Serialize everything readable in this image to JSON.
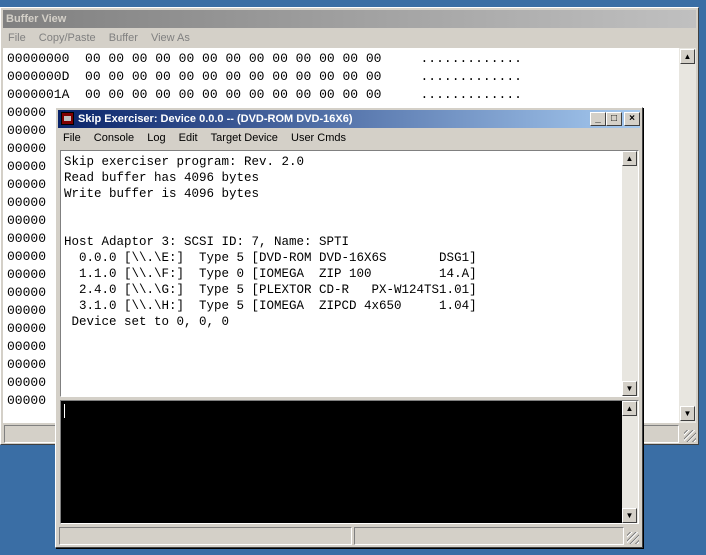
{
  "buffer_view": {
    "title": "Buffer View",
    "menu": [
      "File",
      "Copy/Paste",
      "Buffer",
      "View As"
    ],
    "rows": [
      {
        "addr": "00000000",
        "bytes": "00 00 00 00 00 00 00 00 00 00 00 00 00",
        "ascii": "............."
      },
      {
        "addr": "0000000D",
        "bytes": "00 00 00 00 00 00 00 00 00 00 00 00 00",
        "ascii": "............."
      },
      {
        "addr": "0000001A",
        "bytes": "00 00 00 00 00 00 00 00 00 00 00 00 00",
        "ascii": "............."
      },
      {
        "addr": "00000",
        "bytes": "",
        "ascii": ""
      },
      {
        "addr": "00000",
        "bytes": "",
        "ascii": ""
      },
      {
        "addr": "00000",
        "bytes": "",
        "ascii": ""
      },
      {
        "addr": "00000",
        "bytes": "",
        "ascii": ""
      },
      {
        "addr": "00000",
        "bytes": "",
        "ascii": ""
      },
      {
        "addr": "00000",
        "bytes": "",
        "ascii": ""
      },
      {
        "addr": "00000",
        "bytes": "",
        "ascii": ""
      },
      {
        "addr": "00000",
        "bytes": "",
        "ascii": ""
      },
      {
        "addr": "00000",
        "bytes": "",
        "ascii": ""
      },
      {
        "addr": "00000",
        "bytes": "",
        "ascii": ""
      },
      {
        "addr": "00000",
        "bytes": "",
        "ascii": ""
      },
      {
        "addr": "00000",
        "bytes": "",
        "ascii": ""
      },
      {
        "addr": "00000",
        "bytes": "",
        "ascii": ""
      },
      {
        "addr": "00000",
        "bytes": "",
        "ascii": ""
      },
      {
        "addr": "00000",
        "bytes": "",
        "ascii": ""
      },
      {
        "addr": "00000",
        "bytes": "",
        "ascii": ""
      },
      {
        "addr": "00000",
        "bytes": "",
        "ascii": ""
      }
    ]
  },
  "skip_exerciser": {
    "title": "Skip Exerciser: Device 0.0.0 -- (DVD-ROM DVD-16X6)",
    "menu": [
      "File",
      "Console",
      "Log",
      "Edit",
      "Target Device",
      "User Cmds"
    ],
    "controls": {
      "minimize": "_",
      "maximize": "□",
      "close": "×"
    },
    "console_lines": [
      "Skip exerciser program: Rev. 2.0",
      "Read buffer has 4096 bytes",
      "Write buffer is 4096 bytes",
      "",
      "",
      "Host Adaptor 3: SCSI ID: 7, Name: SPTI",
      "  0.0.0 [\\\\.\\E:]  Type 5 [DVD-ROM DVD-16X6S       DSG1]",
      "  1.1.0 [\\\\.\\F:]  Type 0 [IOMEGA  ZIP 100         14.A]",
      "  2.4.0 [\\\\.\\G:]  Type 5 [PLEXTOR CD-R   PX-W124TS1.01]",
      "  3.1.0 [\\\\.\\H:]  Type 5 [IOMEGA  ZIPCD 4x650     1.04]",
      " Device set to 0, 0, 0"
    ],
    "input_value": ""
  },
  "colors": {
    "desktop": "#3a6ea5",
    "active_title": "#0a246a",
    "inactive_title": "#808080"
  }
}
